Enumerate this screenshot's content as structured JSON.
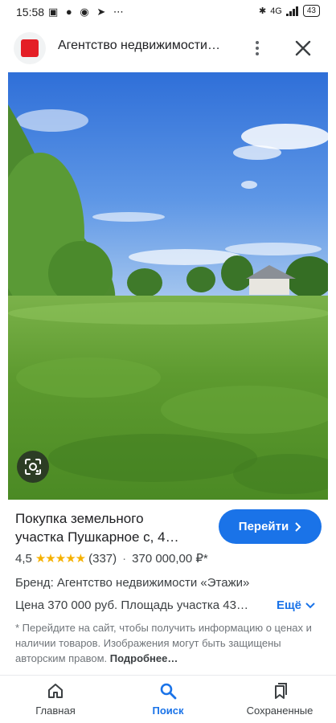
{
  "status_bar": {
    "time": "15:58",
    "left_icons": [
      "nfc-icon",
      "chat-bubble-icon",
      "whatsapp-icon",
      "telegram-icon",
      "more-dots-icon"
    ],
    "network": "4G",
    "battery": "43"
  },
  "header": {
    "site_title": "Агентство недвижимости…",
    "logo_color": "#e41e26"
  },
  "photo": {
    "description_icon": "landscape-photo",
    "lens_icon": "google-lens-icon"
  },
  "product": {
    "title_line1": "Покупка земельного",
    "title_line2": "участка Пушкарное с, 4…",
    "visit_button": "Перейти",
    "rating": "4,5",
    "stars": "★★★★★",
    "reviews": "(337)",
    "separator": "·",
    "price": "370 000,00 ₽*",
    "brand": "Бренд: Агентство недвижимости «Этажи»",
    "description": "Цена 370 000 руб. Площадь участка 43…",
    "more_link": "Ещё"
  },
  "disclaimer": {
    "text": "* Перейдите на сайт, чтобы получить информацию о ценах и наличии товаров. Изображения могут быть защищены авторским правом.",
    "link": "Подробнее…"
  },
  "bottom_nav": {
    "home": "Главная",
    "search": "Поиск",
    "saved": "Сохраненные"
  },
  "colors": {
    "accent": "#1a73e8",
    "star": "#f6b100"
  }
}
